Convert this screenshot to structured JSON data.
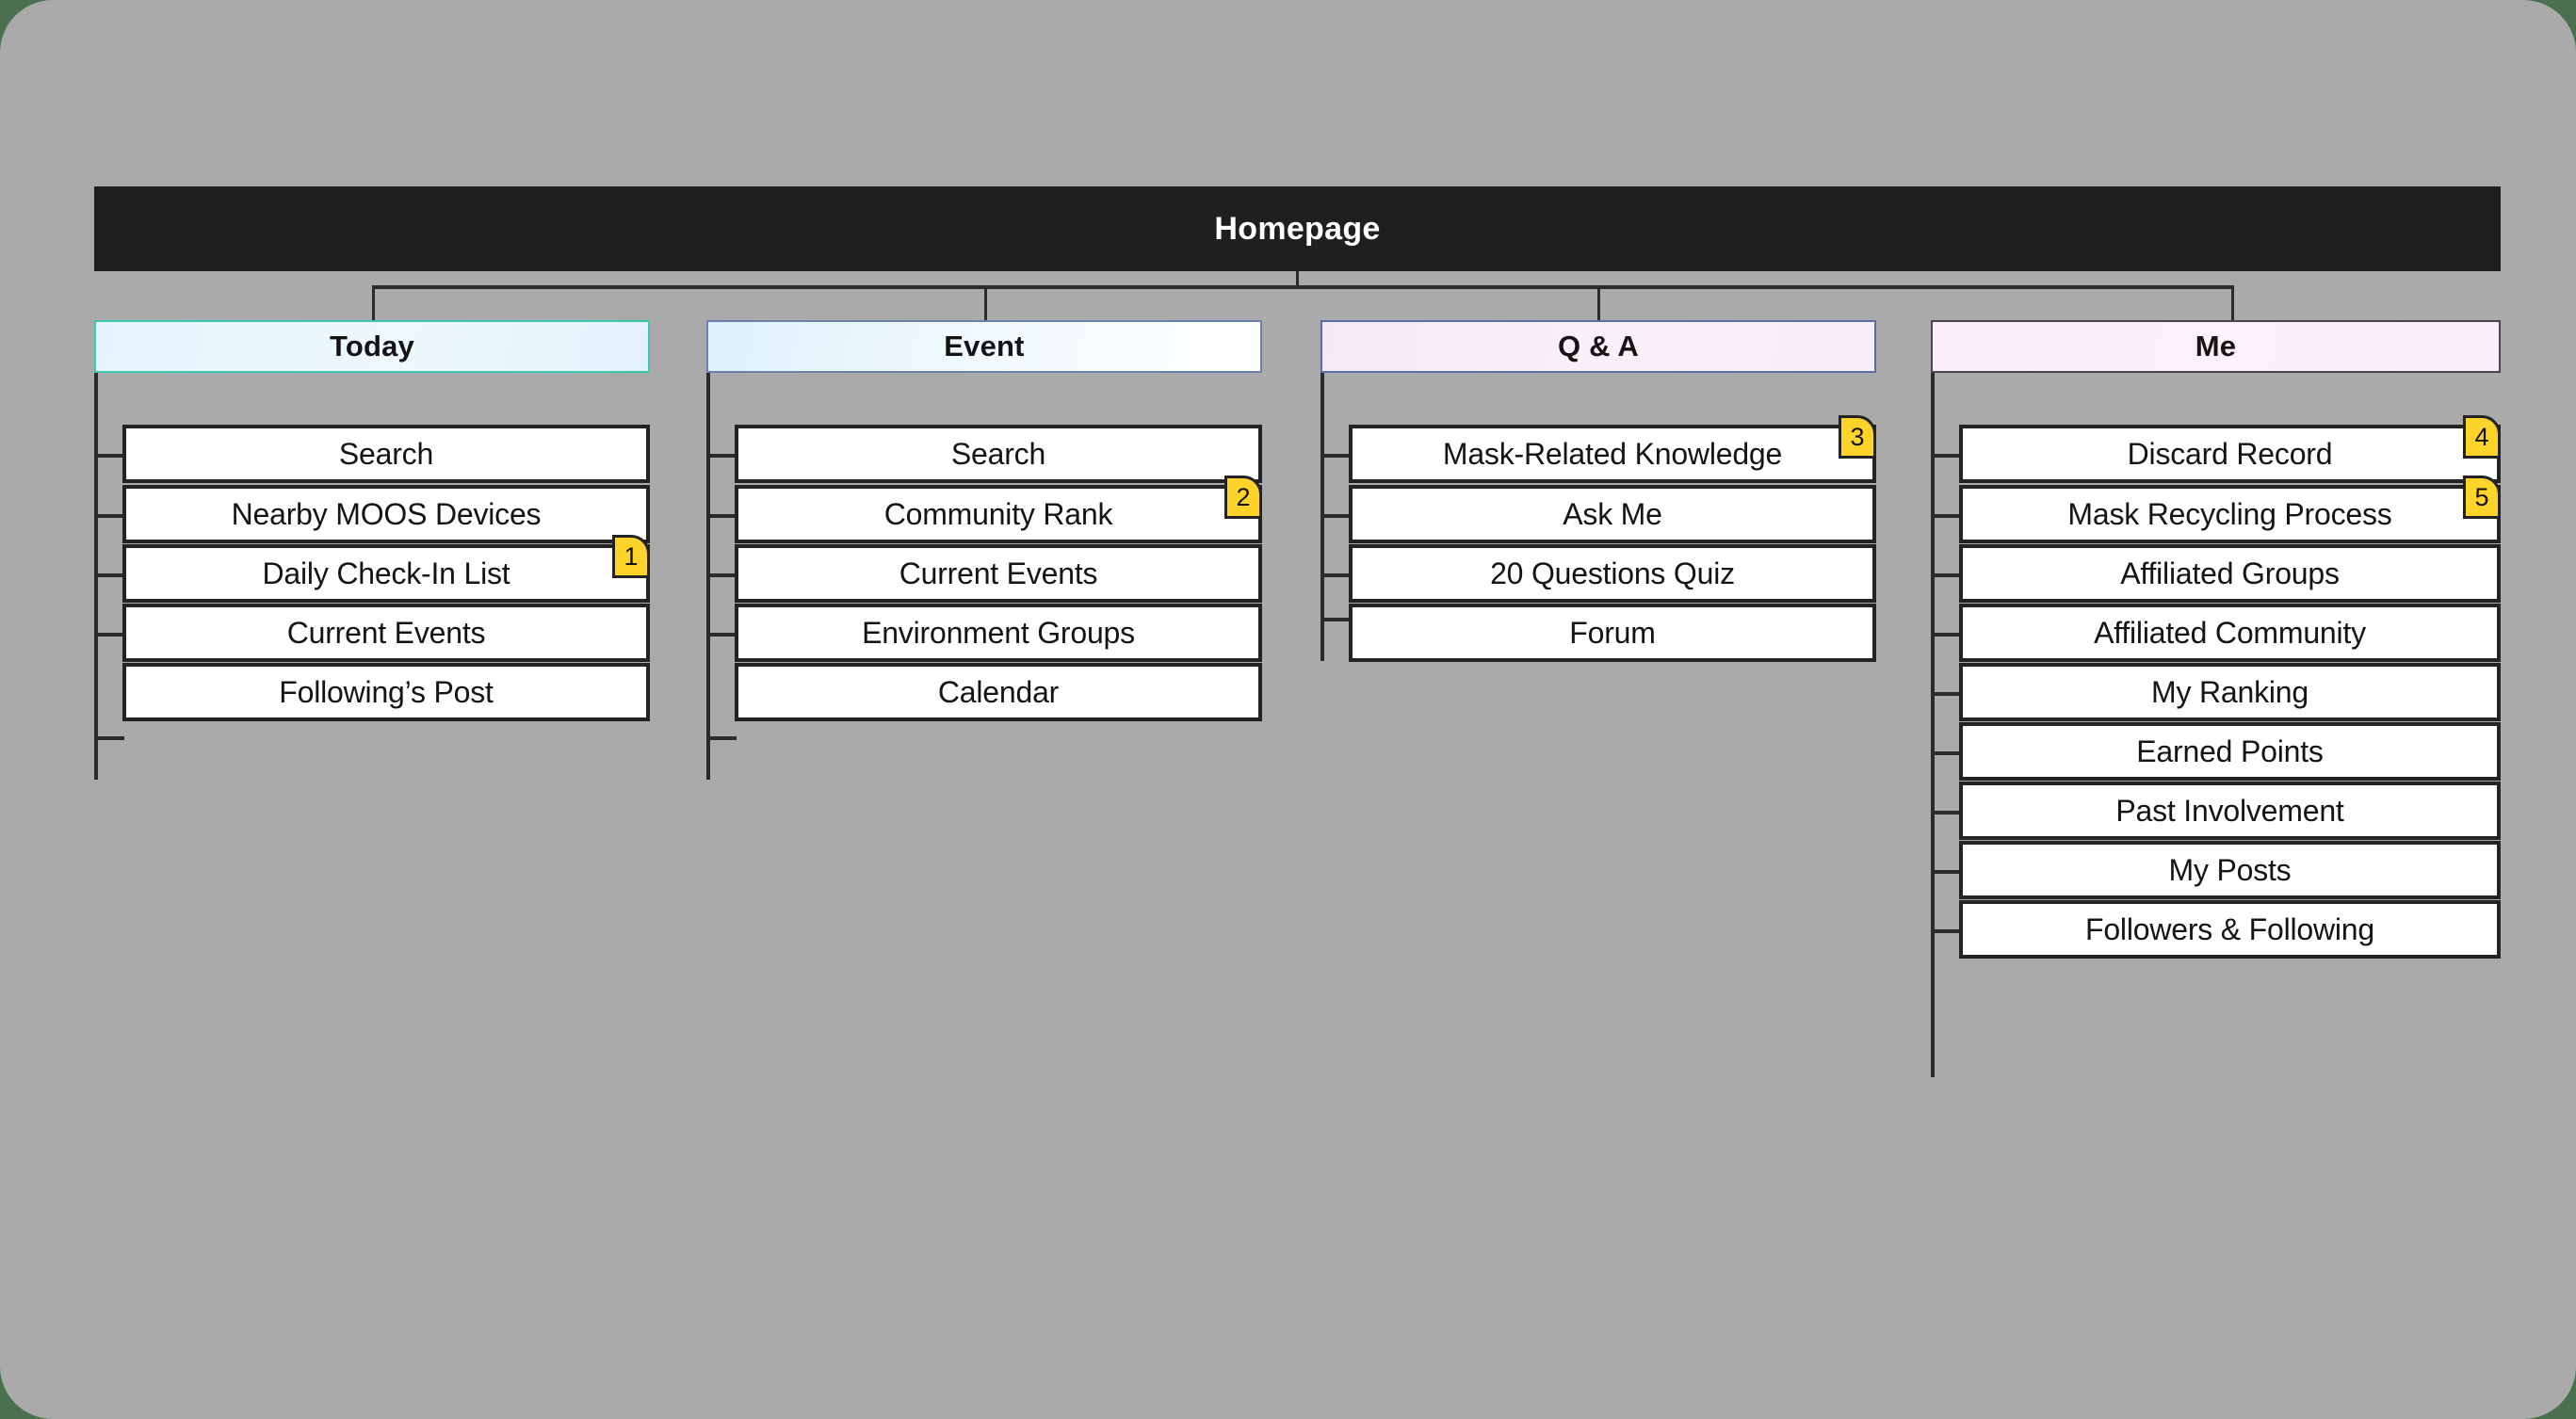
{
  "diagram": {
    "title": "Homepage",
    "background_color": "#aaaaaa",
    "outer_color": "#4a7050",
    "root": {
      "label": "Homepage",
      "fill": "#1f1f1f",
      "text_color": "#ffffff"
    },
    "badge_color": "#ffd42a",
    "columns": [
      {
        "header": "Today",
        "header_fill": "#e8f6fd",
        "header_border": "#3ec6b4",
        "items": [
          {
            "label": "Search",
            "badge": null
          },
          {
            "label": "Nearby MOOS Devices",
            "badge": null
          },
          {
            "label": "Daily Check-In List",
            "badge": "1"
          },
          {
            "label": "Current Events",
            "badge": null
          },
          {
            "label": "Following’s Post",
            "badge": null
          }
        ]
      },
      {
        "header": "Event",
        "header_fill": "#ecf7fd",
        "header_border": "#6b82b0",
        "items": [
          {
            "label": "Search",
            "badge": null
          },
          {
            "label": "Community Rank",
            "badge": "2"
          },
          {
            "label": "Current Events",
            "badge": null
          },
          {
            "label": "Environment Groups",
            "badge": null
          },
          {
            "label": "Calendar",
            "badge": null
          }
        ]
      },
      {
        "header": "Q & A",
        "header_fill": "#f7edf7",
        "header_border": "#5a6fa8",
        "items": [
          {
            "label": "Mask-Related Knowledge",
            "badge": "3"
          },
          {
            "label": "Ask Me",
            "badge": null
          },
          {
            "label": "20 Questions Quiz",
            "badge": null
          },
          {
            "label": "Forum",
            "badge": null
          }
        ]
      },
      {
        "header": "Me",
        "header_fill": "#fbeef8",
        "header_border": "#4b4459",
        "items": [
          {
            "label": "Discard Record",
            "badge": "4"
          },
          {
            "label": "Mask Recycling Process",
            "badge": "5"
          },
          {
            "label": "Affiliated Groups",
            "badge": null
          },
          {
            "label": "Affiliated Community",
            "badge": null
          },
          {
            "label": "My Ranking",
            "badge": null
          },
          {
            "label": "Earned Points",
            "badge": null
          },
          {
            "label": "Past Involvement",
            "badge": null
          },
          {
            "label": "My Posts",
            "badge": null
          },
          {
            "label": "Followers & Following",
            "badge": null
          }
        ]
      }
    ]
  }
}
